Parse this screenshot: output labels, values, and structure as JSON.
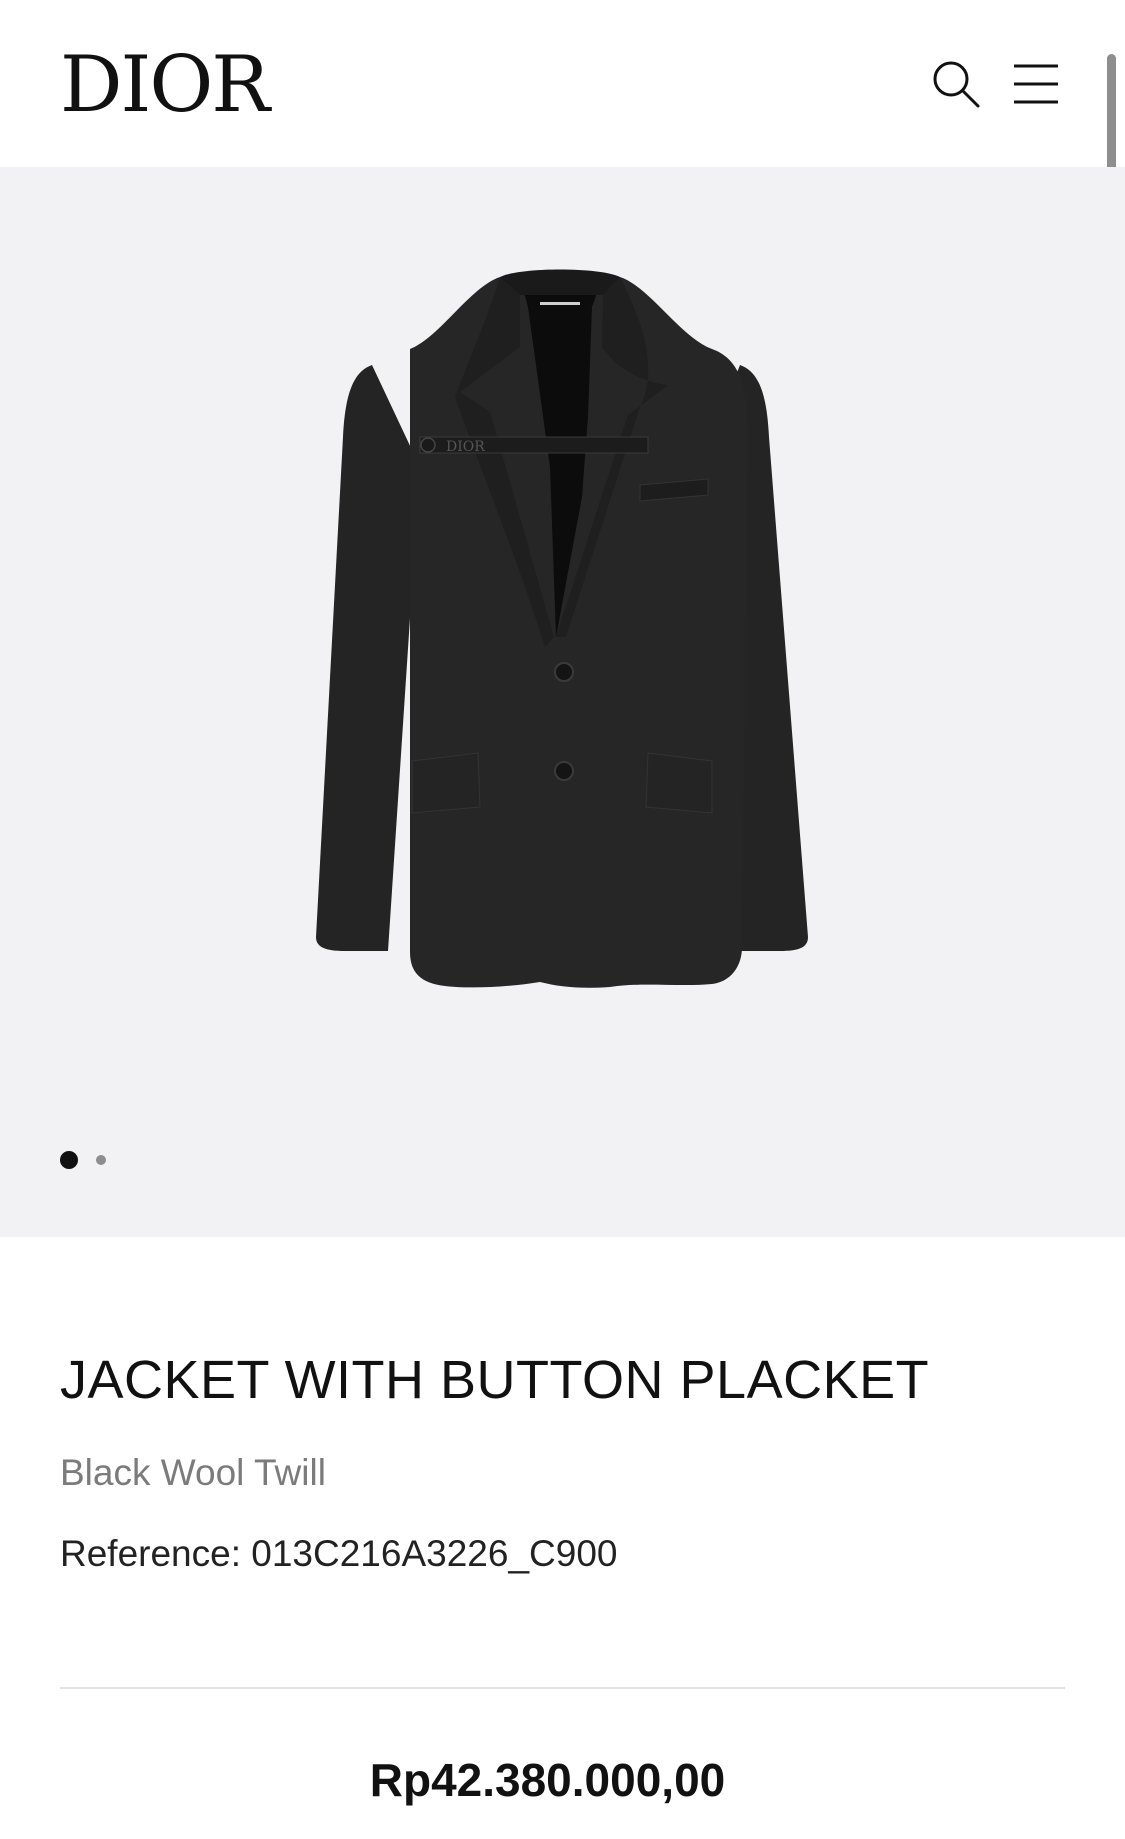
{
  "header": {
    "logo_text": "DIOR",
    "search_icon": "search-icon",
    "menu_icon": "hamburger-menu-icon"
  },
  "gallery": {
    "image_subject": "black single-breasted jacket with button placket",
    "placket_text": "DIOR",
    "image_count": 2,
    "active_index": 1
  },
  "product": {
    "title": "JACKET WITH BUTTON PLACKET",
    "subtitle": "Black Wool Twill",
    "reference": "Reference: 013C216A3226_C900",
    "price": "Rp42.380.000,00"
  },
  "colors": {
    "gallery_background": "#f2f2f4",
    "text": "#111111",
    "muted_text": "#7b7b7b",
    "jacket": "#222222"
  }
}
